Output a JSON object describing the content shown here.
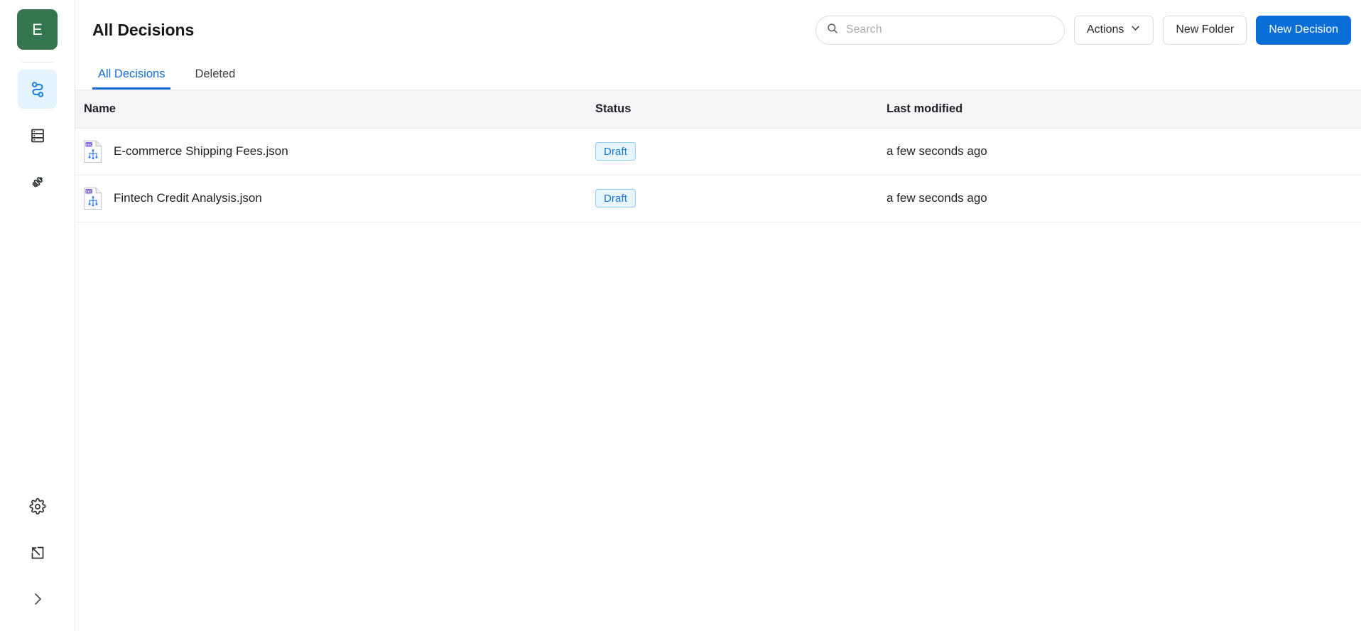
{
  "sidebar": {
    "avatar_initial": "E",
    "nav_items": [
      {
        "icon": "decision-flow-icon",
        "name": "decisions",
        "active": true
      },
      {
        "icon": "data-rack-icon",
        "name": "data",
        "active": false
      },
      {
        "icon": "connections-plug-icon",
        "name": "connections",
        "active": false
      }
    ],
    "bottom_items": [
      {
        "icon": "gear-icon",
        "name": "settings"
      },
      {
        "icon": "collapse-panel-icon",
        "name": "collapse-panel"
      },
      {
        "icon": "chevron-right-icon",
        "name": "expand-sidebar"
      }
    ]
  },
  "header": {
    "title": "All Decisions"
  },
  "search": {
    "placeholder": "Search",
    "value": "",
    "icon": "search-icon"
  },
  "toolbar": {
    "actions_label": "Actions",
    "actions_caret": "chevron-down-icon",
    "new_folder_label": "New Folder",
    "new_decision_label": "New Decision"
  },
  "tabs": [
    {
      "label": "All Decisions",
      "active": true
    },
    {
      "label": "Deleted",
      "active": false
    }
  ],
  "table": {
    "columns": [
      "Name",
      "Status",
      "Last modified"
    ],
    "rows": [
      {
        "icon": "decision-json-file-icon",
        "name": "E-commerce Shipping Fees.json",
        "status": "Draft",
        "last_modified": "a few seconds ago"
      },
      {
        "icon": "decision-json-file-icon",
        "name": "Fintech Credit Analysis.json",
        "status": "Draft",
        "last_modified": "a few seconds ago"
      }
    ]
  },
  "colors": {
    "avatar_green": "#35754f",
    "primary_blue": "#0a6ed8",
    "tab_active_blue": "#156fd4",
    "badge_bg": "#e8f5fd",
    "badge_text": "#1579cf",
    "badge_border": "#8fcdf0",
    "nav_active_bg": "#e4f3fd",
    "icon_blue": "#1a7fe0",
    "file_badge_purple": "#6c4ad0",
    "table_header_bg": "#f4f5f6"
  }
}
